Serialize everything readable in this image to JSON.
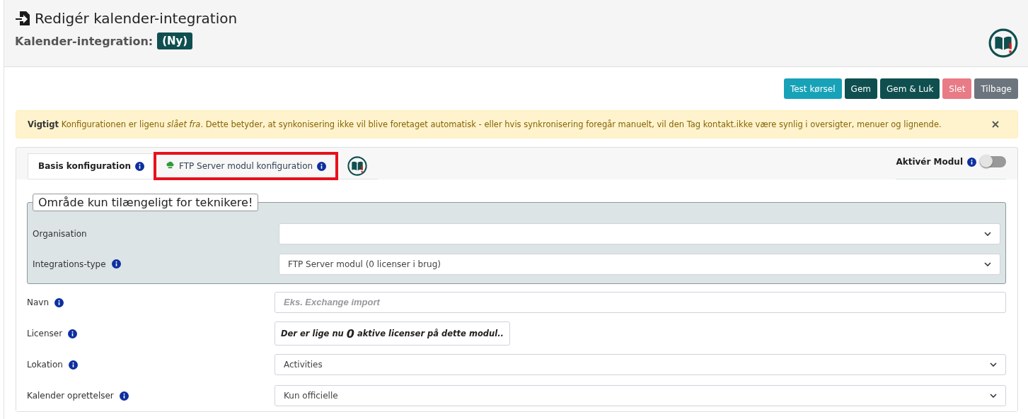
{
  "header": {
    "title": "Redigér kalender-integration",
    "subtitle": "Kalender-integration:",
    "badge": "(Ny)"
  },
  "buttons": [
    {
      "label": "Test kørsel",
      "kind": "info",
      "disabled": false
    },
    {
      "label": "Gem",
      "kind": "primary",
      "disabled": false
    },
    {
      "label": "Gem & Luk",
      "kind": "primary",
      "disabled": false
    },
    {
      "label": "Slet",
      "kind": "danger",
      "disabled": true
    },
    {
      "label": "Tilbage",
      "kind": "secondary",
      "disabled": false
    }
  ],
  "alert": {
    "text": "**Vigtigt** Konfigurationen er ligenu *slået fra*. Dette betyder, at synkonisering ikke vil blive foretaget automatisk - eller hvis synkronisering foregår manuelt, vil den Tag kontakt.ikke være synlig i oversigter, menuer og lignende."
  },
  "tabs": [
    {
      "label": "Basis konfiguration",
      "kind": "text",
      "selected": true,
      "highlighted": false
    },
    {
      "label": "FTP Server modul konfiguration",
      "kind": "cloud",
      "selected": false,
      "highlighted": true
    },
    {
      "kind": "book",
      "selected": false,
      "highlighted": false
    }
  ],
  "module_toggle": {
    "label": "Aktivér Modul",
    "on": false
  },
  "technician_group": {
    "legend": "Område kun tilængeligt for teknikere!",
    "rows": [
      {
        "label": "Organisation",
        "info": false,
        "kind": "select"
      },
      {
        "label": "Integrations-type",
        "info": true,
        "kind": "select",
        "value": "FTP Server modul (0 licenser i brug)"
      }
    ]
  },
  "rows": [
    {
      "label": "Navn",
      "info": true,
      "kind": "input",
      "placeholder": "Eks. Exchange import"
    },
    {
      "label": "Licenser",
      "info": true,
      "kind": "static",
      "before": "Der er lige nu",
      "count": "0",
      "after": "aktive licenser på dette modul.."
    },
    {
      "label": "Lokation",
      "info": true,
      "kind": "select",
      "value": "Activities"
    },
    {
      "label": "Kalender oprettelser",
      "info": true,
      "kind": "select",
      "value": "Kun officielle"
    }
  ]
}
